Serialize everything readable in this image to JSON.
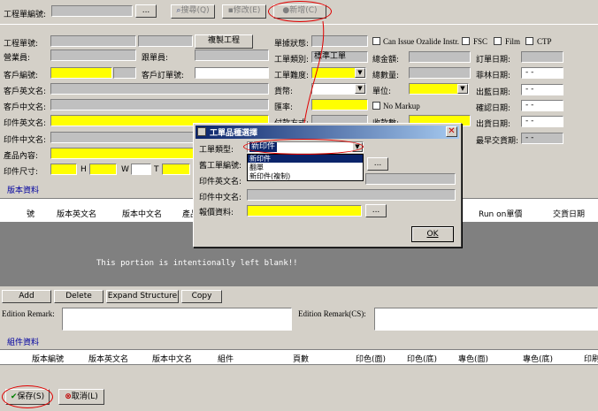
{
  "toolbar": {
    "job_no_label": "工程單編號:",
    "dots": "...",
    "search_label": "搜尋(Q)",
    "modify_label": "修改(E)",
    "new_label": "新增(C)"
  },
  "form": {
    "job_no": "工程單號:",
    "salesperson": "營業員:",
    "customer_no": "客戶編號:",
    "customer_en": "客戶英文名:",
    "customer_cn": "客戶中文名:",
    "print_en": "印件英文名:",
    "print_cn": "印件中文名:",
    "product": "產品內容:",
    "size": "印件尺寸:",
    "h": "H",
    "w": "W",
    "t": "T",
    "clerk": "跟單員:",
    "cust_order": "客戶訂單號:",
    "copy_btn": "複製工程",
    "job_status": "單據狀態:",
    "job_type": "工單類別:",
    "job_type_value": "標準工單",
    "difficulty": "工單難度:",
    "currency": "貨幣:",
    "rate": "匯率:",
    "payment": "付款方式:",
    "close_count": "收款數:",
    "total_amount": "總金額:",
    "total_qty": "總數量:",
    "unit": "單位:",
    "no_markup": "No Markup",
    "can_issue": "Can Issue Ozalide Instr.",
    "fsc": "FSC",
    "film": "Film",
    "ctp": "CTP",
    "order_date": "訂單日期:",
    "sample_date": "菲林日期:",
    "outsample_date": "出藍日期:",
    "confirm_date": "確認日期:",
    "out_date": "出貨日期:",
    "final_date": "最早交貨期:",
    "date_placeholder": "- -"
  },
  "version_section": {
    "title": "版本資料",
    "headers": [
      "號",
      "版本英文名",
      "版本中文名",
      "產品",
      "Run on單價",
      "交貨日期"
    ],
    "blank_text": "This portion is intentionally left blank!!",
    "add": "Add",
    "delete": "Delete",
    "expand": "Expand Structure",
    "copy": "Copy",
    "edition_remark": "Edition Remark:",
    "edition_remark_cs": "Edition Remark(CS):"
  },
  "component_section": {
    "title": "組件資料",
    "headers": [
      "版本編號",
      "版本英文名",
      "版本中文名",
      "組件",
      "頁數",
      "印色(面)",
      "印色(底)",
      "專色(面)",
      "專色(底)",
      "印刷"
    ]
  },
  "bottom": {
    "save": "保存(S)",
    "cancel": "取消(L)"
  },
  "dialog": {
    "title": "工單品種選擇",
    "type_label": "工單類型:",
    "type_value": "新印件",
    "options": [
      "新印件",
      "翻單",
      "新印件(複制)"
    ],
    "old_job_label": "舊工單編號:",
    "print_en_label": "印件英文名:",
    "print_cn_label": "印件中文名:",
    "quote_label": "報價資料:",
    "dots": "...",
    "ok": "OK"
  },
  "colors": {
    "background": "#d4d0c8",
    "title_bar": "#0a246a",
    "required_field": "#ffff00",
    "annotation": "#e00000"
  }
}
